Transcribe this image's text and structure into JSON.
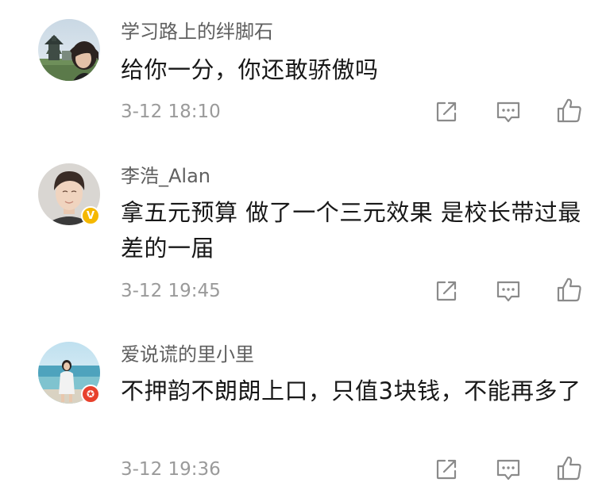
{
  "colors": {
    "username": "#5f5f5f",
    "text": "#181818",
    "time": "#9a9a9a",
    "icon": "#8a8a8a",
    "verified_badge": "#f5b800",
    "member_badge": "#e8412c"
  },
  "comments": [
    {
      "username": "学习路上的绊脚石",
      "text": "给你一分，你还敢骄傲吗",
      "time": "3-12 18:10",
      "badge": null
    },
    {
      "username": "李浩_Alan",
      "text": "拿五元预算 做了一个三元效果 是校长带过最差的一届",
      "time": "3-12 19:45",
      "badge": "V"
    },
    {
      "username": "爱说谎的里小里",
      "text": "不押韵不朗朗上口，只值3块钱，不能再多了",
      "time": "3-12 19:36",
      "badge": "✪"
    }
  ],
  "action_icons": [
    "share-icon",
    "comment-icon",
    "like-icon"
  ]
}
